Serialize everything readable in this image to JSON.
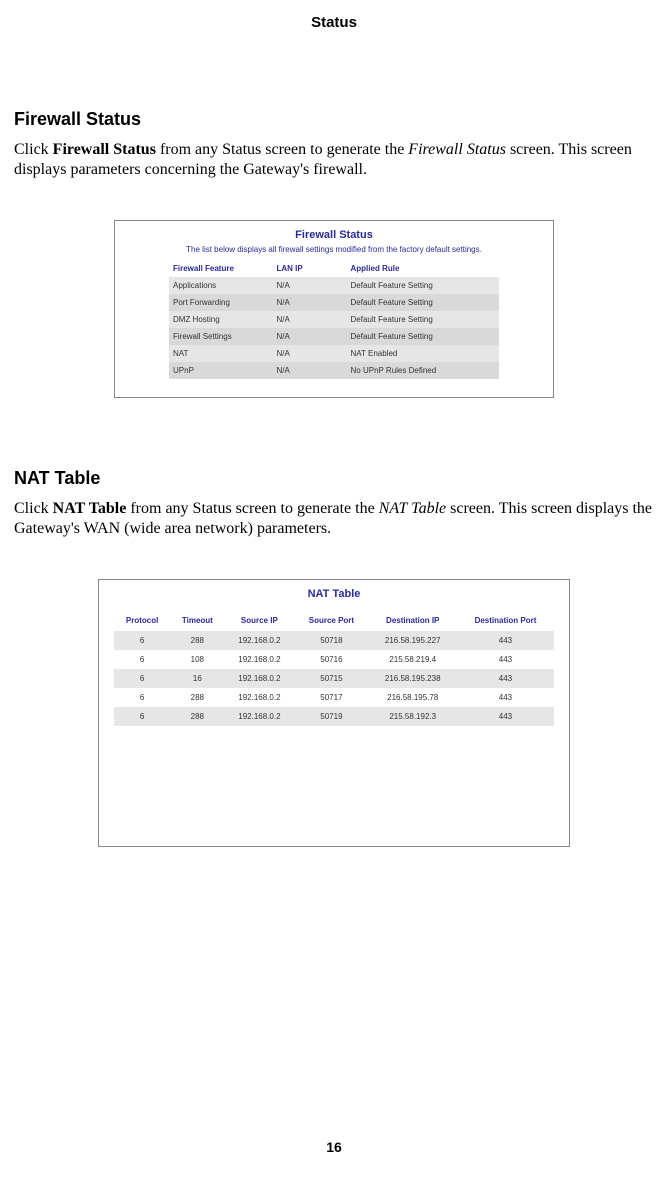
{
  "header": "Status",
  "page_number": "16",
  "section1": {
    "heading": "Firewall Status",
    "para_pre": "Click ",
    "para_bold": "Firewall Status",
    "para_mid": " from any Status screen to generate the ",
    "para_ital": "Firewall Status",
    "para_post": " screen. This screen displays parameters concerning the Gateway's firewall."
  },
  "fig1": {
    "title": "Firewall Status",
    "desc": "The list below displays all firewall settings modified from the factory default settings.",
    "headers": [
      "Firewall Feature",
      "LAN IP",
      "Applied Rule"
    ],
    "rows": [
      [
        "Applications",
        "N/A",
        "Default Feature Setting"
      ],
      [
        "Port Forwarding",
        "N/A",
        "Default Feature Setting"
      ],
      [
        "DMZ Hosting",
        "N/A",
        "Default Feature Setting"
      ],
      [
        "Firewall Settings",
        "N/A",
        "Default Feature Setting"
      ],
      [
        "NAT",
        "N/A",
        "NAT Enabled"
      ],
      [
        "UPnP",
        "N/A",
        "No UPnP Rules Defined"
      ]
    ]
  },
  "section2": {
    "heading": "NAT Table",
    "para_pre": "Click ",
    "para_bold": "NAT Table",
    "para_mid": " from any Status screen to generate the ",
    "para_ital": "NAT Table",
    "para_post": " screen. This screen displays the Gateway's WAN (wide area network) parameters."
  },
  "fig2": {
    "title": "NAT Table",
    "headers": [
      "Protocol",
      "Timeout",
      "Source IP",
      "Source Port",
      "Destination IP",
      "Destination Port"
    ],
    "rows": [
      [
        "6",
        "288",
        "192.168.0.2",
        "50718",
        "216.58.195.227",
        "443"
      ],
      [
        "6",
        "108",
        "192.168.0.2",
        "50716",
        "215.58.219.4",
        "443"
      ],
      [
        "6",
        "16",
        "192.168.0.2",
        "50715",
        "216.58.195.238",
        "443"
      ],
      [
        "6",
        "288",
        "192.168.0.2",
        "50717",
        "216.58.195.78",
        "443"
      ],
      [
        "6",
        "288",
        "192.168.0.2",
        "50719",
        "215.58.192.3",
        "443"
      ]
    ]
  }
}
